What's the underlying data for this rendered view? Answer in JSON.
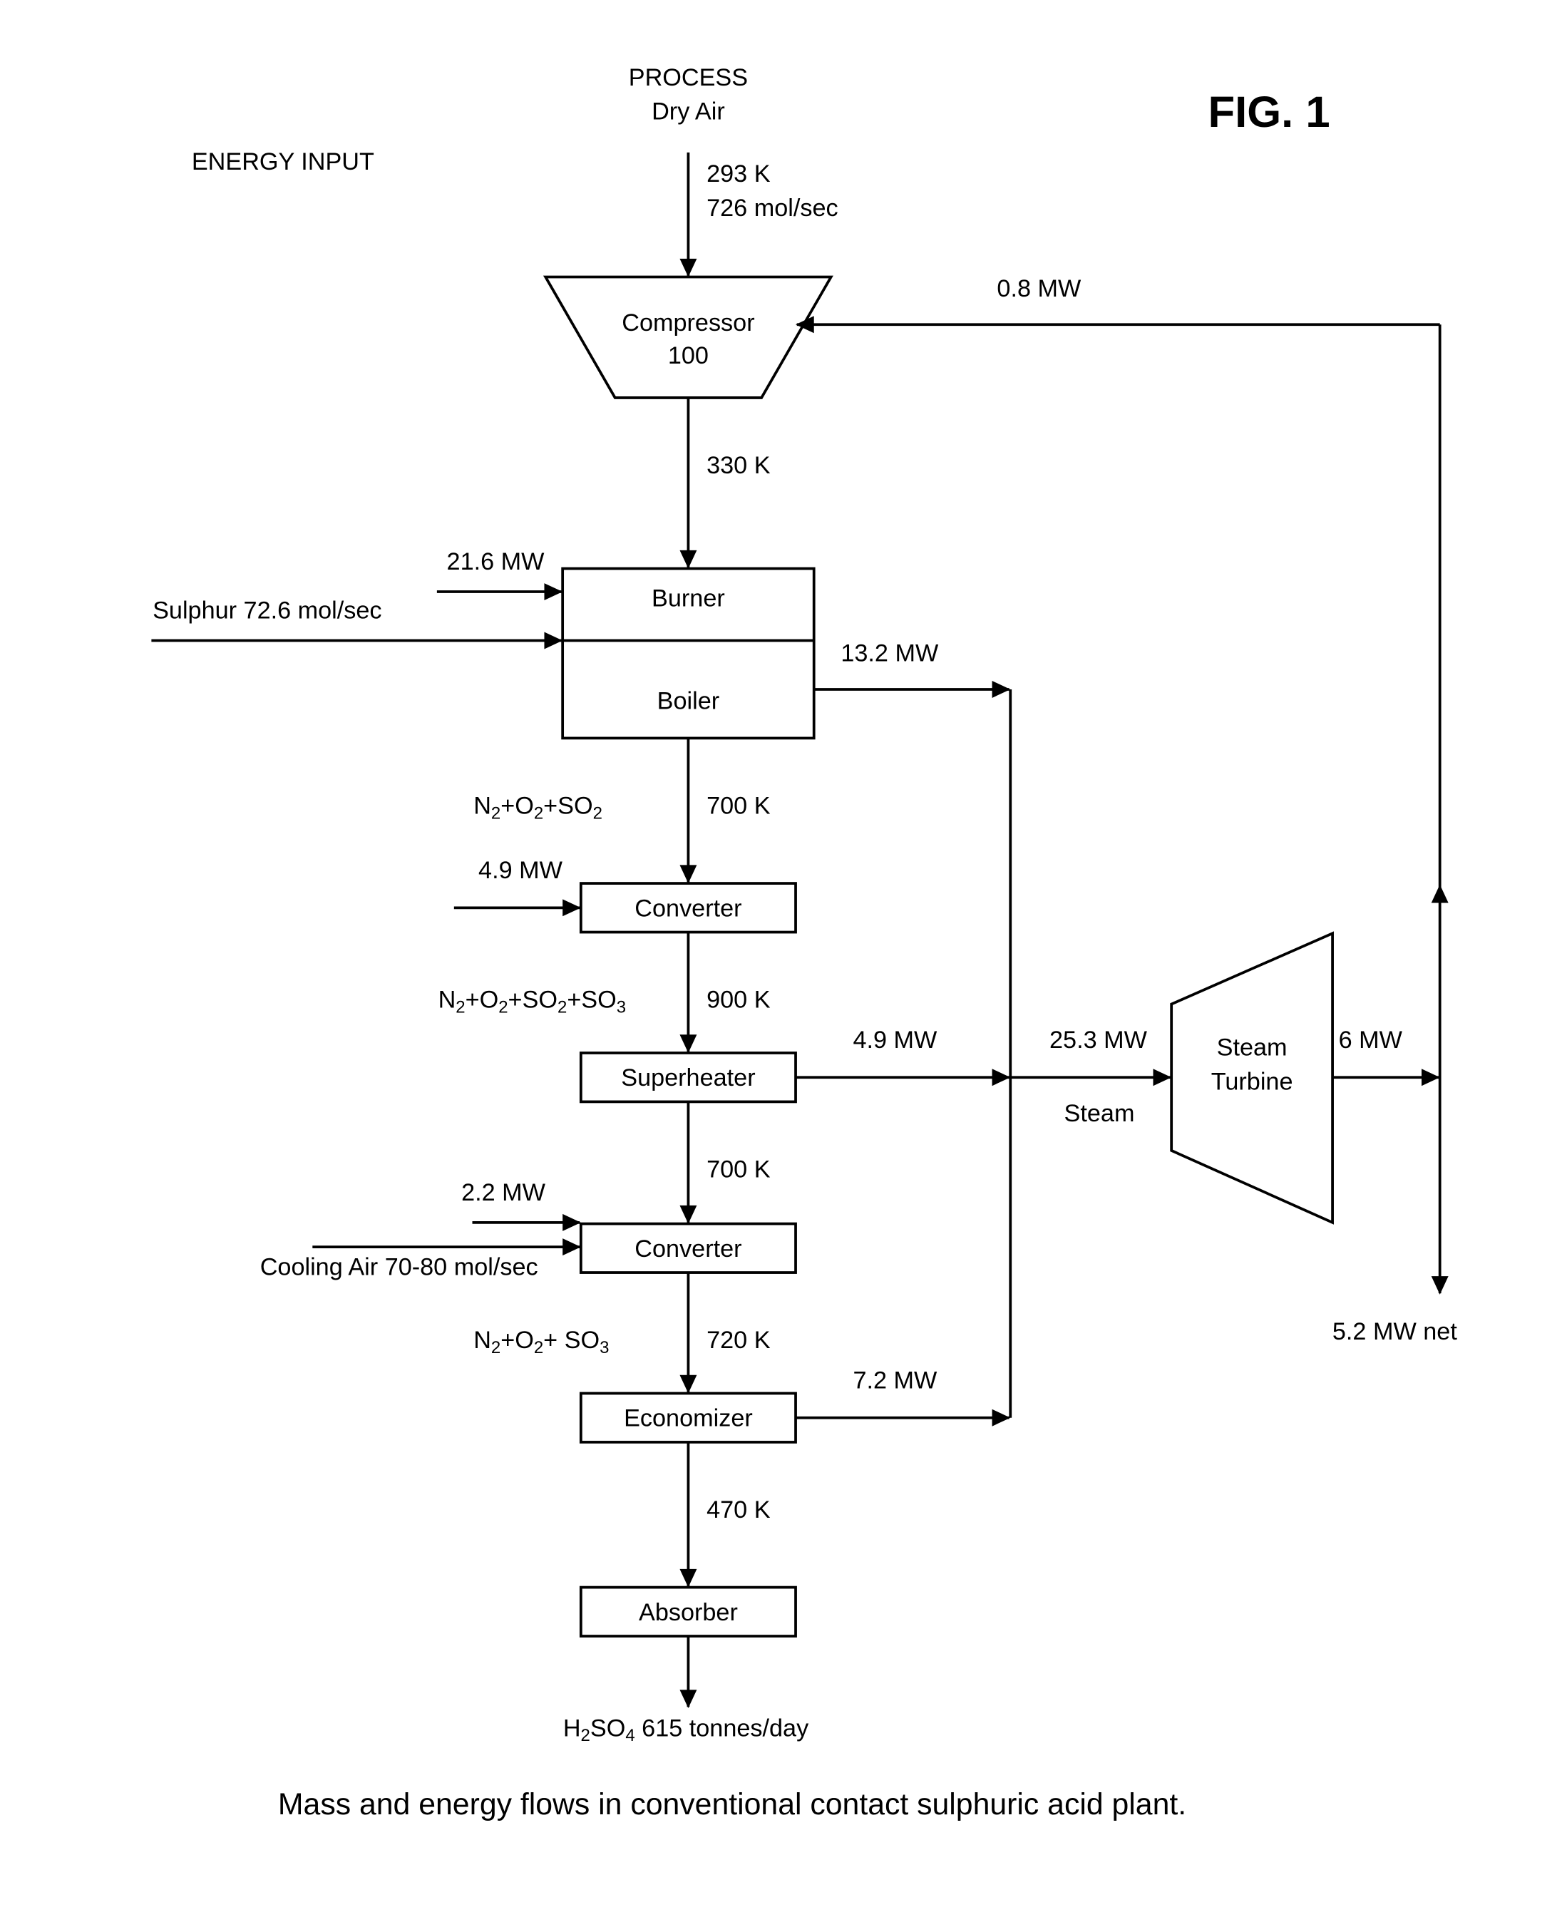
{
  "figure": {
    "label": "FIG. 1",
    "caption": "Mass and energy flows in conventional contact sulphuric acid plant."
  },
  "headers": {
    "energy_input": "ENERGY INPUT",
    "process": "PROCESS",
    "dry_air": "Dry Air"
  },
  "units": {
    "compressor": {
      "line1": "Compressor",
      "line2": "100"
    },
    "burner": "Burner",
    "boiler": "Boiler",
    "converter1": "Converter",
    "superheater": "Superheater",
    "converter2": "Converter",
    "economizer": "Economizer",
    "absorber": "Absorber",
    "steam_turbine": {
      "line1": "Steam",
      "line2": "Turbine"
    }
  },
  "streams": {
    "air_in_temp": "293 K",
    "air_in_flow": "726 mol/sec",
    "after_compressor_temp": "330 K",
    "after_boiler_temp": "700 K",
    "after_boiler_composition": {
      "parts": [
        "N",
        "2",
        "+O",
        "2",
        "+SO",
        "2"
      ]
    },
    "after_converter1_temp": "900 K",
    "after_converter1_composition": {
      "parts": [
        "N",
        "2",
        "+O",
        "2",
        "+SO",
        "2",
        "+SO",
        "3"
      ]
    },
    "after_superheater_temp": "700 K",
    "after_converter2_temp": "720 K",
    "after_converter2_composition": {
      "parts": [
        "N",
        "2",
        "+O",
        "2",
        "+ SO",
        "3"
      ]
    },
    "after_economizer_temp": "470 K",
    "product": {
      "parts": [
        "H",
        "2",
        "SO",
        "4",
        " 615 tonnes/day"
      ]
    },
    "sulphur_feed": "Sulphur 72.6 mol/sec",
    "cooling_air": "Cooling Air 70-80 mol/sec",
    "steam": "Steam"
  },
  "energy": {
    "burner_input": "21.6 MW",
    "converter1_input": "4.9 MW",
    "converter2_input": "2.2 MW",
    "boiler_output": "13.2 MW",
    "superheater_output": "4.9 MW",
    "economizer_output": "7.2 MW",
    "steam_total": "25.3 MW",
    "turbine_output": "6 MW",
    "compressor_return": "0.8 MW",
    "net_output": "5.2 MW net"
  }
}
